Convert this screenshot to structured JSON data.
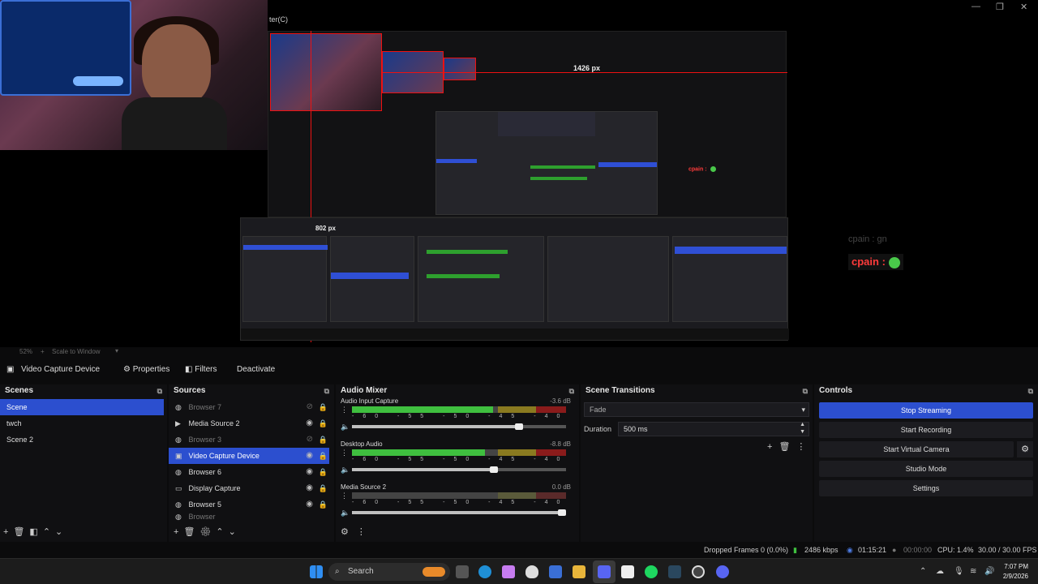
{
  "window": {
    "title_fragment": "ter(C)",
    "controls": [
      "—",
      "❐",
      "✕"
    ]
  },
  "preview": {
    "measure_label_top": "1426 px",
    "measure_label_left": "802 px",
    "chat_faded": "cpain : gn",
    "chat_main": "cpain :",
    "chat_small": "cpain :",
    "nested_scenes": [
      "Scene",
      "twch",
      "Scene 2"
    ]
  },
  "zoom": {
    "level": "52%",
    "mode": "Scale to Window"
  },
  "context": {
    "source_name": "Video Capture Device",
    "properties": "Properties",
    "filters": "Filters",
    "deactivate": "Deactivate"
  },
  "scenes": {
    "title": "Scenes",
    "items": [
      {
        "label": "Scene",
        "selected": true
      },
      {
        "label": "twch",
        "selected": false
      },
      {
        "label": "Scene 2",
        "selected": false
      }
    ]
  },
  "sources": {
    "title": "Sources",
    "items": [
      {
        "label": "Browser 7",
        "icon": "globe-icon",
        "visible": false
      },
      {
        "label": "Media Source 2",
        "icon": "play-icon",
        "visible": true
      },
      {
        "label": "Browser 3",
        "icon": "globe-icon",
        "visible": false
      },
      {
        "label": "Video Capture Device",
        "icon": "camera-icon",
        "visible": true,
        "selected": true
      },
      {
        "label": "Browser 6",
        "icon": "globe-icon",
        "visible": true
      },
      {
        "label": "Display Capture",
        "icon": "monitor-icon",
        "visible": true
      },
      {
        "label": "Browser 5",
        "icon": "globe-icon",
        "visible": true
      },
      {
        "label": "Browser",
        "icon": "globe-icon",
        "visible": true
      }
    ]
  },
  "mixer": {
    "title": "Audio Mixer",
    "scale": "-60 -55 -50 -45 -40 -35 -30 -25 -20 -15 -10 -5 0",
    "channels": [
      {
        "name": "Audio Input Capture",
        "db": "-3.6 dB",
        "level": 0.66,
        "volume": 0.8
      },
      {
        "name": "Desktop Audio",
        "db": "-8.8 dB",
        "level": 0.62,
        "volume": 0.68
      },
      {
        "name": "Media Source 2",
        "db": "0.0 dB",
        "level": 0.0,
        "volume": 1.0
      }
    ]
  },
  "transitions": {
    "title": "Scene Transitions",
    "type": "Fade",
    "duration_label": "Duration",
    "duration_value": "500 ms"
  },
  "controls": {
    "title": "Controls",
    "buttons": [
      "Stop Streaming",
      "Start Recording",
      "Start Virtual Camera",
      "Studio Mode",
      "Settings"
    ]
  },
  "status": {
    "dropped": "Dropped Frames 0 (0.0%)",
    "bitrate": "2486 kbps",
    "stream_time": "01:15:21",
    "rec_time": "00:00:00",
    "cpu": "CPU: 1.4%",
    "fps": "30.00 / 30.00 FPS"
  },
  "taskbar": {
    "search": "Search",
    "time": "7:07 PM",
    "date": "2/9/2026"
  },
  "colors": {
    "accent": "#2c4fcf",
    "meter_green": "#3fbf3f",
    "live_red": "#ff3b3b"
  }
}
